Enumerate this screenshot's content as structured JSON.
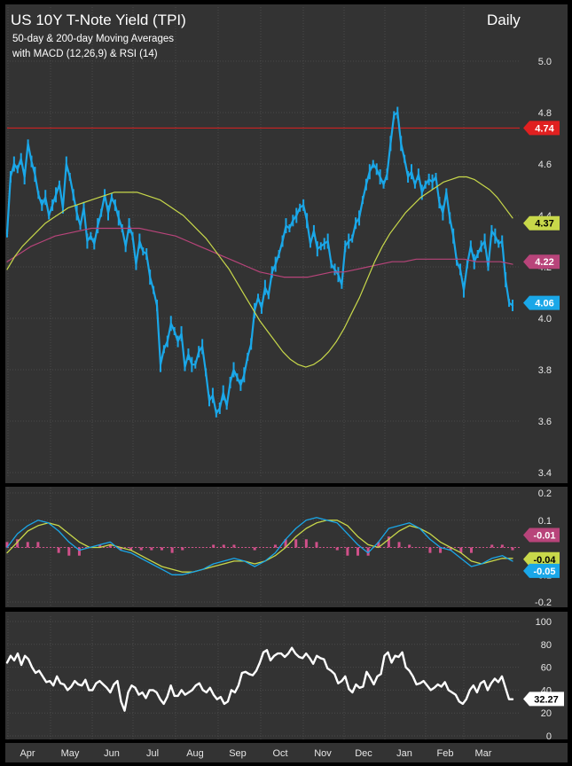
{
  "header": {
    "title": "US 10Y T-Note Yield (TPI)",
    "subtitle_1": "50-day & 200-day Moving Averages",
    "subtitle_2": "with MACD (12,26,9) & RSI (14)",
    "period": "Daily"
  },
  "colors": {
    "background": "#333333",
    "frame": "#000000",
    "grid": "#4a4a4a",
    "price": "#1aa7e8",
    "ma50": "#c8d84a",
    "ma200": "#b8447a",
    "reference_line": "#e02020",
    "macd_line": "#1aa7e8",
    "signal_line": "#c8d84a",
    "histogram": "#d0508a",
    "rsi": "#ffffff"
  },
  "chart_data": [
    {
      "type": "line",
      "panel": "price",
      "x": [
        "Apr",
        "May",
        "Jun",
        "Jul",
        "Aug",
        "Sep",
        "Oct",
        "Nov",
        "Dec",
        "Jan",
        "Feb",
        "Mar"
      ],
      "ylim": [
        3.4,
        5.0
      ],
      "yticks": [
        3.4,
        3.6,
        3.8,
        4.0,
        4.2,
        4.4,
        4.6,
        4.8,
        5.0
      ],
      "ytick_labels": [
        "3.4",
        "3.6",
        "3.8",
        "4.0",
        "4.2",
        "4.4",
        "4.6",
        "4.8",
        "5.0"
      ],
      "reference_line": 4.74,
      "series": [
        {
          "role": "price",
          "values": [
            4.33,
            4.55,
            4.6,
            4.58,
            4.62,
            4.55,
            4.68,
            4.61,
            4.56,
            4.48,
            4.44,
            4.47,
            4.4,
            4.44,
            4.48,
            4.52,
            4.43,
            4.6,
            4.55,
            4.48,
            4.41,
            4.36,
            4.43,
            4.3,
            4.32,
            4.29,
            4.36,
            4.41,
            4.48,
            4.41,
            4.47,
            4.44,
            4.39,
            4.35,
            4.28,
            4.36,
            4.32,
            4.21,
            4.3,
            4.26,
            4.25,
            4.16,
            4.11,
            4.05,
            3.82,
            3.88,
            3.91,
            3.98,
            3.95,
            3.91,
            3.94,
            3.81,
            3.86,
            3.82,
            3.82,
            3.87,
            3.89,
            3.79,
            3.68,
            3.7,
            3.63,
            3.65,
            3.71,
            3.66,
            3.75,
            3.8,
            3.77,
            3.74,
            3.78,
            3.85,
            3.9,
            4.03,
            4.08,
            4.04,
            4.12,
            4.09,
            4.18,
            4.21,
            4.25,
            4.3,
            4.36,
            4.35,
            4.38,
            4.4,
            4.43,
            4.44,
            4.38,
            4.29,
            4.34,
            4.27,
            4.28,
            4.29,
            4.3,
            4.21,
            4.19,
            4.17,
            4.13,
            4.28,
            4.3,
            4.31,
            4.37,
            4.39,
            4.46,
            4.52,
            4.57,
            4.6,
            4.58,
            4.55,
            4.52,
            4.56,
            4.68,
            4.79,
            4.8,
            4.68,
            4.62,
            4.55,
            4.57,
            4.52,
            4.56,
            4.49,
            4.52,
            4.54,
            4.53,
            4.55,
            4.45,
            4.41,
            4.49,
            4.39,
            4.32,
            4.22,
            4.19,
            4.11,
            4.21,
            4.28,
            4.22,
            4.25,
            4.28,
            4.3,
            4.2,
            4.34,
            4.32,
            4.29,
            4.3,
            4.15,
            4.06,
            4.05
          ]
        },
        {
          "role": "ma50",
          "values": [
            4.19,
            4.24,
            4.28,
            4.31,
            4.34,
            4.37,
            4.39,
            4.41,
            4.43,
            4.44,
            4.45,
            4.46,
            4.47,
            4.48,
            4.49,
            4.49,
            4.49,
            4.49,
            4.48,
            4.47,
            4.46,
            4.44,
            4.42,
            4.4,
            4.37,
            4.34,
            4.31,
            4.27,
            4.23,
            4.19,
            4.14,
            4.09,
            4.04,
            3.99,
            3.95,
            3.91,
            3.87,
            3.84,
            3.82,
            3.81,
            3.82,
            3.84,
            3.87,
            3.91,
            3.96,
            4.02,
            4.08,
            4.15,
            4.22,
            4.28,
            4.33,
            4.37,
            4.41,
            4.44,
            4.47,
            4.49,
            4.51,
            4.53,
            4.54,
            4.55,
            4.55,
            4.54,
            4.52,
            4.5,
            4.47,
            4.43,
            4.39
          ]
        },
        {
          "role": "ma200",
          "values": [
            4.22,
            4.25,
            4.28,
            4.3,
            4.32,
            4.33,
            4.34,
            4.35,
            4.35,
            4.35,
            4.35,
            4.35,
            4.34,
            4.33,
            4.32,
            4.3,
            4.28,
            4.26,
            4.24,
            4.22,
            4.2,
            4.18,
            4.17,
            4.16,
            4.16,
            4.16,
            4.17,
            4.18,
            4.18,
            4.19,
            4.2,
            4.21,
            4.22,
            4.22,
            4.23,
            4.23,
            4.23,
            4.23,
            4.23,
            4.22,
            4.22,
            4.22,
            4.21
          ]
        }
      ],
      "labels": [
        {
          "value": 4.74,
          "text": "4.74",
          "series": "reference_line"
        },
        {
          "value": 4.37,
          "text": "4.37",
          "series": "ma50"
        },
        {
          "value": 4.22,
          "text": "4.22",
          "series": "ma200"
        },
        {
          "value": 4.06,
          "text": "4.06",
          "series": "price"
        }
      ]
    },
    {
      "type": "line",
      "panel": "macd",
      "ylim": [
        -0.2,
        0.2
      ],
      "yticks": [
        -0.2,
        -0.1,
        0.0,
        0.1,
        0.2
      ],
      "ytick_labels": [
        "-0.2",
        "-0.1",
        "",
        "0.1",
        "0.2"
      ],
      "series": [
        {
          "role": "macd",
          "values": [
            0.0,
            0.05,
            0.08,
            0.1,
            0.09,
            0.06,
            0.02,
            -0.01,
            0.0,
            0.01,
            0.02,
            -0.01,
            -0.02,
            -0.04,
            -0.06,
            -0.08,
            -0.1,
            -0.1,
            -0.09,
            -0.08,
            -0.06,
            -0.05,
            -0.04,
            -0.05,
            -0.07,
            -0.05,
            -0.02,
            0.03,
            0.07,
            0.1,
            0.11,
            0.1,
            0.09,
            0.05,
            0.01,
            -0.02,
            0.02,
            0.07,
            0.08,
            0.09,
            0.07,
            0.03,
            0.0,
            -0.01,
            -0.04,
            -0.07,
            -0.06,
            -0.04,
            -0.03,
            -0.05
          ]
        },
        {
          "role": "signal",
          "values": [
            -0.02,
            0.02,
            0.06,
            0.08,
            0.09,
            0.08,
            0.05,
            0.02,
            0.0,
            0.0,
            0.01,
            0.0,
            -0.01,
            -0.03,
            -0.05,
            -0.07,
            -0.08,
            -0.09,
            -0.09,
            -0.08,
            -0.07,
            -0.06,
            -0.05,
            -0.05,
            -0.06,
            -0.05,
            -0.03,
            0.0,
            0.04,
            0.07,
            0.09,
            0.1,
            0.1,
            0.08,
            0.04,
            0.01,
            0.0,
            0.03,
            0.06,
            0.08,
            0.07,
            0.05,
            0.02,
            0.0,
            -0.02,
            -0.05,
            -0.06,
            -0.05,
            -0.04,
            -0.04
          ]
        },
        {
          "role": "histogram",
          "values": [
            0.02,
            0.03,
            0.02,
            0.02,
            0.0,
            -0.02,
            -0.03,
            -0.03,
            0.0,
            0.01,
            0.01,
            -0.01,
            -0.01,
            -0.01,
            -0.01,
            -0.01,
            -0.02,
            -0.01,
            0.0,
            0.0,
            0.01,
            0.01,
            0.01,
            0.0,
            -0.01,
            0.0,
            0.01,
            0.03,
            0.03,
            0.03,
            0.02,
            0.0,
            -0.01,
            -0.03,
            -0.03,
            -0.03,
            0.02,
            0.04,
            0.02,
            0.01,
            0.0,
            -0.02,
            -0.02,
            -0.01,
            -0.02,
            -0.02,
            0.0,
            0.01,
            0.01,
            -0.01
          ]
        }
      ],
      "labels": [
        {
          "value": -0.01,
          "text": "-0.01",
          "series": "histogram"
        },
        {
          "value": -0.04,
          "text": "-0.04",
          "series": "signal"
        },
        {
          "value": -0.05,
          "text": "-0.05",
          "series": "macd"
        }
      ]
    },
    {
      "type": "line",
      "panel": "rsi",
      "ylim": [
        0,
        100
      ],
      "yticks": [
        0,
        20,
        40,
        60,
        80,
        100
      ],
      "ytick_labels": [
        "0",
        "20",
        "40",
        "60",
        "80",
        "100"
      ],
      "series": [
        {
          "role": "rsi",
          "values": [
            64,
            70,
            66,
            72,
            62,
            70,
            67,
            60,
            55,
            57,
            52,
            47,
            48,
            44,
            52,
            46,
            45,
            40,
            43,
            48,
            45,
            44,
            49,
            40,
            40,
            46,
            48,
            45,
            42,
            38,
            45,
            48,
            30,
            22,
            38,
            44,
            42,
            36,
            38,
            33,
            40,
            40,
            38,
            32,
            28,
            34,
            44,
            35,
            35,
            40,
            36,
            38,
            40,
            44,
            46,
            40,
            38,
            42,
            36,
            32,
            34,
            28,
            30,
            40,
            38,
            44,
            55,
            56,
            54,
            53,
            57,
            64,
            73,
            75,
            66,
            70,
            72,
            72,
            69,
            72,
            77,
            72,
            69,
            68,
            72,
            68,
            63,
            70,
            68,
            67,
            59,
            57,
            54,
            46,
            48,
            52,
            41,
            38,
            45,
            42,
            43,
            56,
            51,
            45,
            52,
            54,
            70,
            73,
            64,
            70,
            69,
            73,
            60,
            57,
            52,
            45,
            46,
            48,
            44,
            40,
            42,
            45,
            43,
            47,
            40,
            38,
            36,
            30,
            28,
            32,
            40,
            44,
            38,
            46,
            48,
            40,
            46,
            50,
            47,
            52,
            42,
            32,
            32
          ]
        }
      ],
      "labels": [
        {
          "value": 32.27,
          "text": "32.27",
          "series": "rsi"
        }
      ]
    }
  ],
  "x_axis": {
    "labels": [
      "Apr",
      "May",
      "Jun",
      "Jul",
      "Aug",
      "Sep",
      "Oct",
      "Nov",
      "Dec",
      "Jan",
      "Feb",
      "Mar"
    ]
  }
}
